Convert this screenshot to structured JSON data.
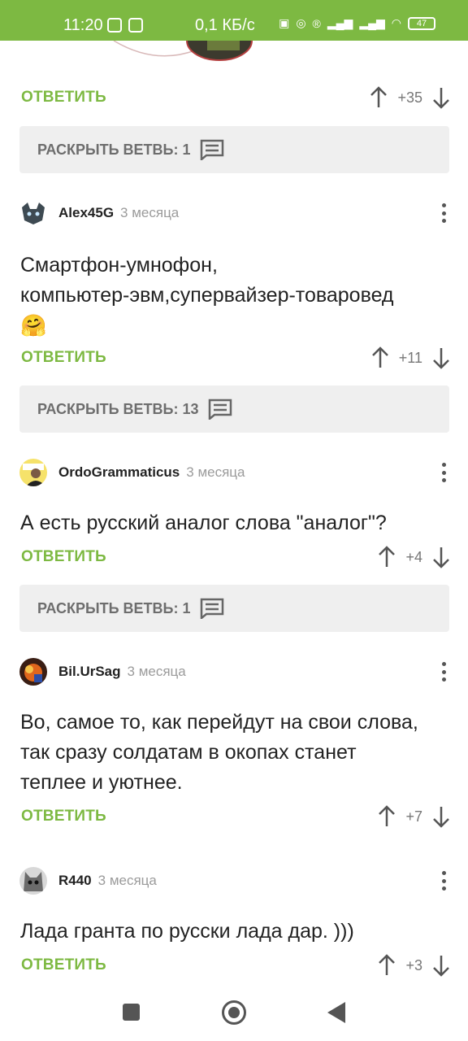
{
  "status_bar": {
    "time": "11:20",
    "net_speed": "0,1 КБ/с",
    "battery": "47"
  },
  "labels": {
    "reply": "ОТВЕТИТЬ",
    "expand_prefix": "РАСКРЫТЬ ВЕТВЬ: "
  },
  "top": {
    "votes": "+35",
    "expand": "РАСКРЫТЬ ВЕТВЬ: 1"
  },
  "comments": [
    {
      "author": "Alex45G",
      "time": "3 месяца",
      "text_line1": "Смартфон-умнофон,",
      "text_line2": "компьютер-эвм,супервайзер-товаровед",
      "emoji": "🤗",
      "votes": "+11",
      "expand": "РАСКРЫТЬ ВЕТВЬ: 13"
    },
    {
      "author": "OrdoGrammaticus",
      "time": "3 месяца",
      "text_line1": "А есть русский аналог слова \"аналог\"?",
      "votes": "+4",
      "expand": "РАСКРЫТЬ ВЕТВЬ: 1"
    },
    {
      "author": "Bil.UrSag",
      "time": "3 месяца",
      "text_line1": "Во, самое то, как перейдут на свои слова,",
      "text_line2": "так сразу солдатам в окопах станет",
      "text_line3": "теплее и уютнее.",
      "votes": "+7"
    },
    {
      "author": "R440",
      "time": "3 месяца",
      "text_line1": "Лада гранта по русски лада дар. )))",
      "votes": "+3"
    }
  ],
  "colors": {
    "accent": "#7db942",
    "expand_bg": "#efefef"
  }
}
